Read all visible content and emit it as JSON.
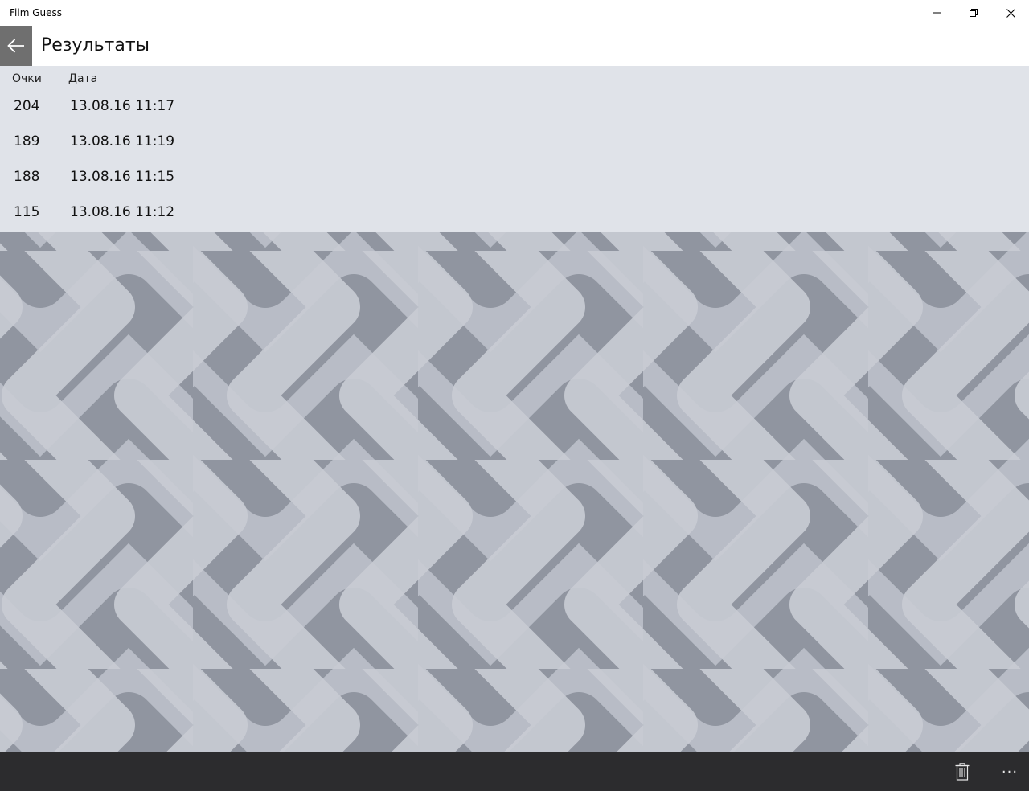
{
  "window": {
    "title": "Film Guess",
    "minimize_icon": "minimize-icon",
    "restore_icon": "restore-icon",
    "close_icon": "close-icon"
  },
  "header": {
    "title": "Результаты",
    "back_icon": "back-arrow-icon"
  },
  "results": {
    "columns": {
      "score": "Очки",
      "date": "Дата"
    },
    "rows": [
      {
        "score": "204",
        "date": "13.08.16 11:17"
      },
      {
        "score": "189",
        "date": "13.08.16 11:19"
      },
      {
        "score": "188",
        "date": "13.08.16 11:15"
      },
      {
        "score": "115",
        "date": "13.08.16 11:12"
      }
    ]
  },
  "commandbar": {
    "delete_icon": "trash-icon",
    "more_label": "···"
  },
  "colors": {
    "results_background": "#e0e3e9",
    "back_button": "#6f6f6f",
    "commandbar": "#242426",
    "pattern_light": "#c9ccd4",
    "pattern_dark": "#8e939d"
  }
}
